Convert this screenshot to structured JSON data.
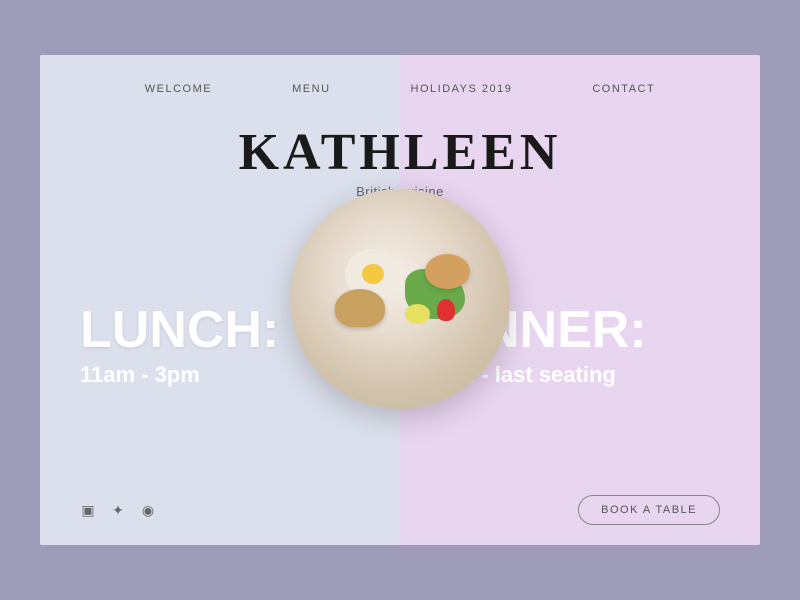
{
  "nav": {
    "items": [
      {
        "id": "welcome",
        "label": "WELCOME"
      },
      {
        "id": "menu",
        "label": "MENU"
      },
      {
        "id": "holidays",
        "label": "HOLIDAYS 2019"
      },
      {
        "id": "contact",
        "label": "CONTACT"
      }
    ]
  },
  "hero": {
    "name": "KATHLEEN",
    "subtitle": "British cuisine"
  },
  "lunch": {
    "title": "LUNCH:",
    "hours": "11am - 3pm"
  },
  "dinner": {
    "title": "DINNER:",
    "hours": "4pm - last seating"
  },
  "footer": {
    "book_label": "BOOK A TABLE",
    "social": [
      {
        "id": "instagram",
        "icon": "⊡"
      },
      {
        "id": "twitter",
        "icon": "𝕏"
      },
      {
        "id": "whatsapp",
        "icon": "◎"
      }
    ]
  },
  "colors": {
    "bg_page": "#9e9bb8",
    "bg_left": "#dce0ec",
    "bg_right": "#e8d5f0"
  }
}
